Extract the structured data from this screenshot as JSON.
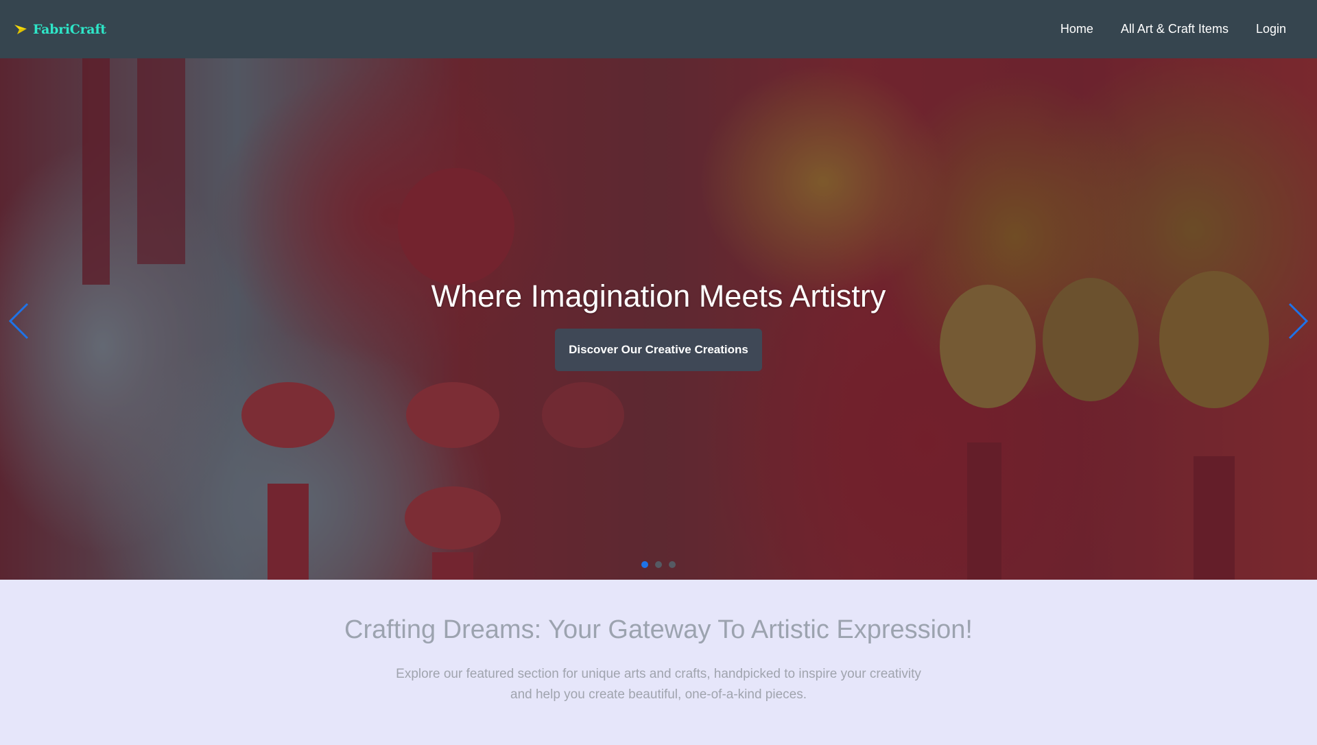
{
  "navbar": {
    "brand_name": "FabriCraft",
    "brand_icon": "paper-plane-icon",
    "links": [
      {
        "label": "Home"
      },
      {
        "label": "All Art & Craft Items"
      },
      {
        "label": "Login"
      }
    ]
  },
  "hero": {
    "title": "Where Imagination Meets Artistry",
    "button_label": "Discover Our Creative Creations",
    "prev_icon": "chevron-left-icon",
    "next_icon": "chevron-right-icon",
    "slide_count": 3,
    "active_slide": 1
  },
  "featured": {
    "title": "Crafting Dreams: Your Gateway To Artistic Expression!",
    "description_line1": "Explore our featured section for unique arts and crafts, handpicked to inspire your creativity",
    "description_line2": "and help you create beautiful, one-of-a-kind pieces."
  },
  "colors": {
    "navbar_bg": "#36454f",
    "brand": "#2ee6c8",
    "accent": "#1e73e8",
    "section_bg": "#e6e6fa"
  }
}
